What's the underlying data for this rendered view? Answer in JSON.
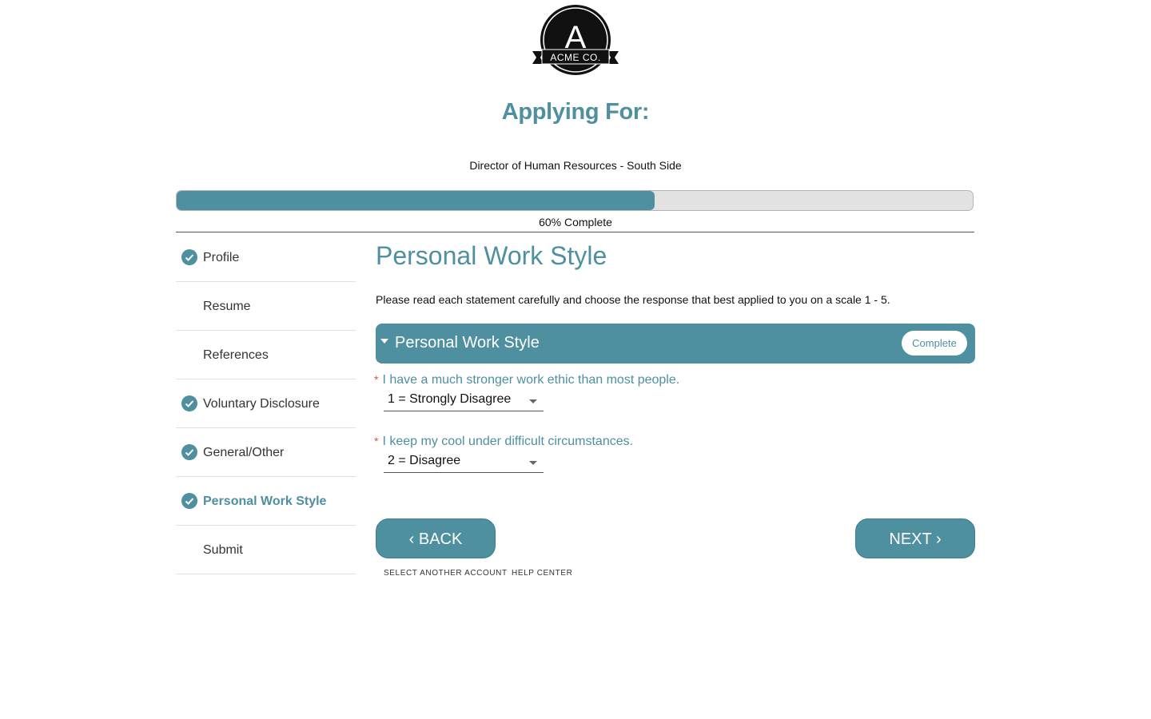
{
  "logo": {
    "letter": "A",
    "text": "ACME CO."
  },
  "header": {
    "title": "Applying For:",
    "position": "Director of Human Resources - South Side"
  },
  "progress": {
    "percent": 60,
    "label": "60% Complete",
    "fill_color": "#4e8fa0"
  },
  "sidebar": {
    "items": [
      {
        "label": "Profile",
        "completed": true,
        "active": false
      },
      {
        "label": "Resume",
        "completed": false,
        "active": false
      },
      {
        "label": "References",
        "completed": false,
        "active": false
      },
      {
        "label": "Voluntary Disclosure",
        "completed": true,
        "active": false
      },
      {
        "label": "General/Other",
        "completed": true,
        "active": false
      },
      {
        "label": "Personal Work Style",
        "completed": true,
        "active": true
      },
      {
        "label": "Submit",
        "completed": false,
        "active": false
      }
    ]
  },
  "main": {
    "title": "Personal Work Style",
    "instructions": "Please read each statement carefully and choose the response that best applied to you on a scale 1 - 5.",
    "section": {
      "title": "Personal Work Style",
      "status": "Complete"
    },
    "questions": [
      {
        "required_mark": "*",
        "text": "I have a much stronger work ethic than most people.",
        "selected": "1 = Strongly Disagree"
      },
      {
        "required_mark": "*",
        "text": "I keep my cool under difficult circumstances.",
        "selected": "2 = Disagree"
      }
    ]
  },
  "nav": {
    "back_label": "BACK",
    "next_label": "NEXT"
  },
  "footer": {
    "links": [
      "SELECT ANOTHER ACCOUNT",
      "HELP CENTER"
    ]
  },
  "colors": {
    "accent": "#4e8fa0",
    "required": "#d9534f",
    "track": "#e2e2e2"
  }
}
